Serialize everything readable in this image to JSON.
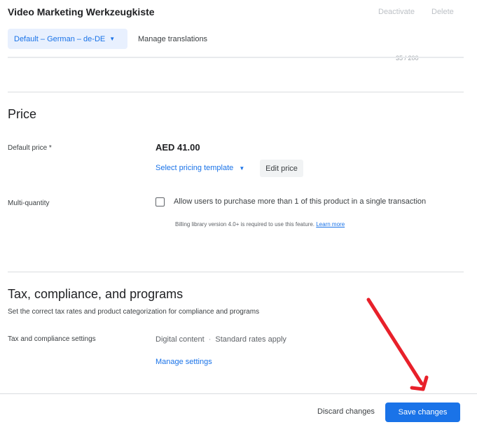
{
  "header": {
    "title": "Video Marketing Werkzeugkiste",
    "deactivate_label": "Deactivate",
    "delete_label": "Delete",
    "language_selector": "Default – German – de-DE",
    "manage_translations_label": "Manage translations",
    "char_count": "35 / 200"
  },
  "price_section": {
    "title": "Price",
    "default_price_label": "Default price  *",
    "price_value": "AED 41.00",
    "pricing_template_label": "Select pricing template",
    "edit_price_label": "Edit price",
    "multi_quantity_label": "Multi-quantity",
    "multi_quantity_checkbox_label": "Allow users to purchase more than 1 of this product in a single transaction",
    "multi_quantity_checked": false,
    "billing_note": "Billing library version 4.0+ is required to use this feature.",
    "learn_more_label": "Learn more"
  },
  "tax_section": {
    "title": "Tax, compliance, and programs",
    "subtitle": "Set the correct tax rates and product categorization for compliance and programs",
    "settings_label": "Tax and compliance settings",
    "content_type": "Digital content",
    "rates": "Standard rates apply",
    "manage_settings_label": "Manage settings"
  },
  "footer": {
    "discard_label": "Discard changes",
    "save_label": "Save changes"
  },
  "colors": {
    "accent": "#1a73e8",
    "annotation_arrow": "#e8202a"
  }
}
